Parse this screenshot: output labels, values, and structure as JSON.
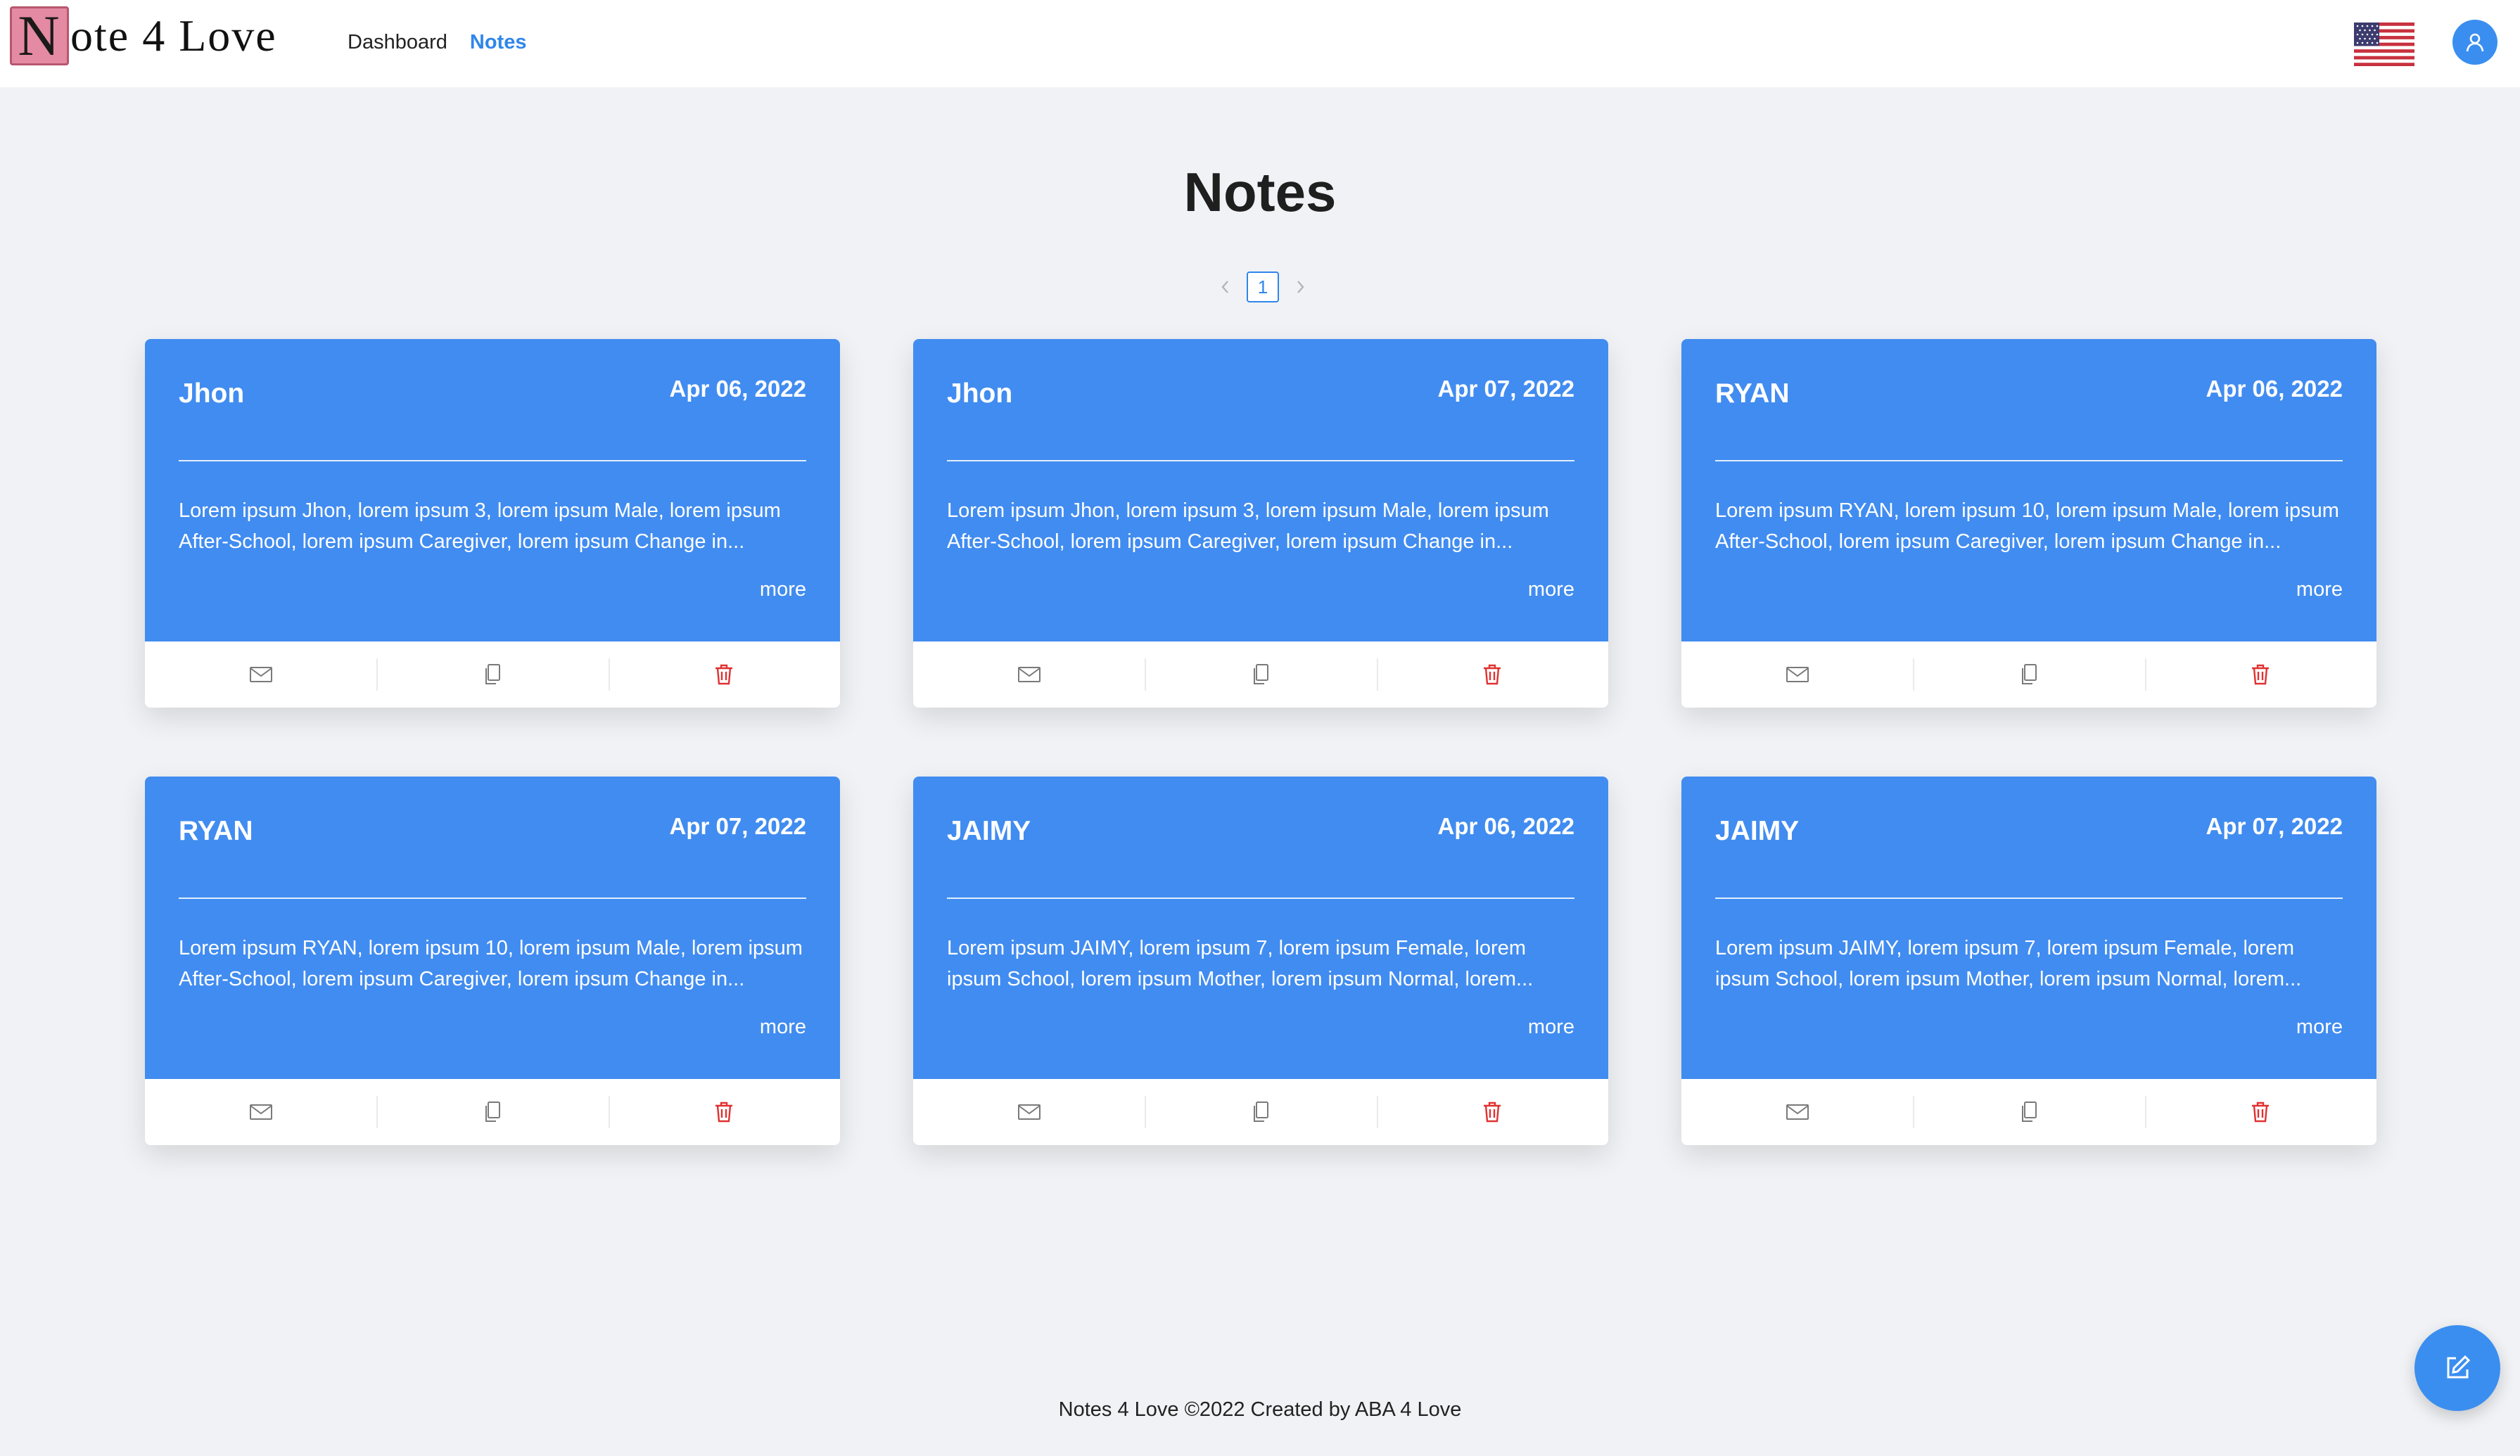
{
  "header": {
    "logo_initial": "N",
    "logo_rest": "ote 4 Love",
    "nav": [
      {
        "label": "Dashboard",
        "active": false
      },
      {
        "label": "Notes",
        "active": true
      }
    ],
    "language_flag": "us-flag-icon",
    "user_icon": "user-icon"
  },
  "page": {
    "title": "Notes",
    "pagination": {
      "current": "1",
      "prev_icon": "chevron-left-icon",
      "next_icon": "chevron-right-icon"
    }
  },
  "notes": [
    {
      "name": "Jhon",
      "date": "Apr 06, 2022",
      "text": "Lorem ipsum Jhon, lorem ipsum 3, lorem ipsum Male, lorem ipsum After-School, lorem ipsum Caregiver, lorem ipsum Change in...",
      "more": "more"
    },
    {
      "name": "Jhon",
      "date": "Apr 07, 2022",
      "text": "Lorem ipsum Jhon, lorem ipsum 3, lorem ipsum Male, lorem ipsum After-School, lorem ipsum Caregiver, lorem ipsum Change in...",
      "more": "more"
    },
    {
      "name": "RYAN",
      "date": "Apr 06, 2022",
      "text": "Lorem ipsum RYAN, lorem ipsum 10, lorem ipsum Male, lorem ipsum After-School, lorem ipsum Caregiver, lorem ipsum Change in...",
      "more": "more"
    },
    {
      "name": "RYAN",
      "date": "Apr 07, 2022",
      "text": "Lorem ipsum RYAN, lorem ipsum 10, lorem ipsum Male, lorem ipsum After-School, lorem ipsum Caregiver, lorem ipsum Change in...",
      "more": "more"
    },
    {
      "name": "JAIMY",
      "date": "Apr 06, 2022",
      "text": "Lorem ipsum JAIMY, lorem ipsum 7, lorem ipsum Female, lorem ipsum School, lorem ipsum Mother, lorem ipsum Normal, lorem...",
      "more": "more"
    },
    {
      "name": "JAIMY",
      "date": "Apr 07, 2022",
      "text": "Lorem ipsum JAIMY, lorem ipsum 7, lorem ipsum Female, lorem ipsum School, lorem ipsum Mother, lorem ipsum Normal, lorem...",
      "more": "more"
    }
  ],
  "card_actions": [
    "mail-icon",
    "copy-icon",
    "delete-icon"
  ],
  "footer": {
    "text": "Notes 4 Love ©2022 Created by ABA 4 Love"
  },
  "fab": {
    "icon": "edit-icon"
  },
  "colors": {
    "card": "#418cf0",
    "accent": "#2f86eb",
    "delete": "#e03131",
    "background": "#f0f2f5"
  }
}
